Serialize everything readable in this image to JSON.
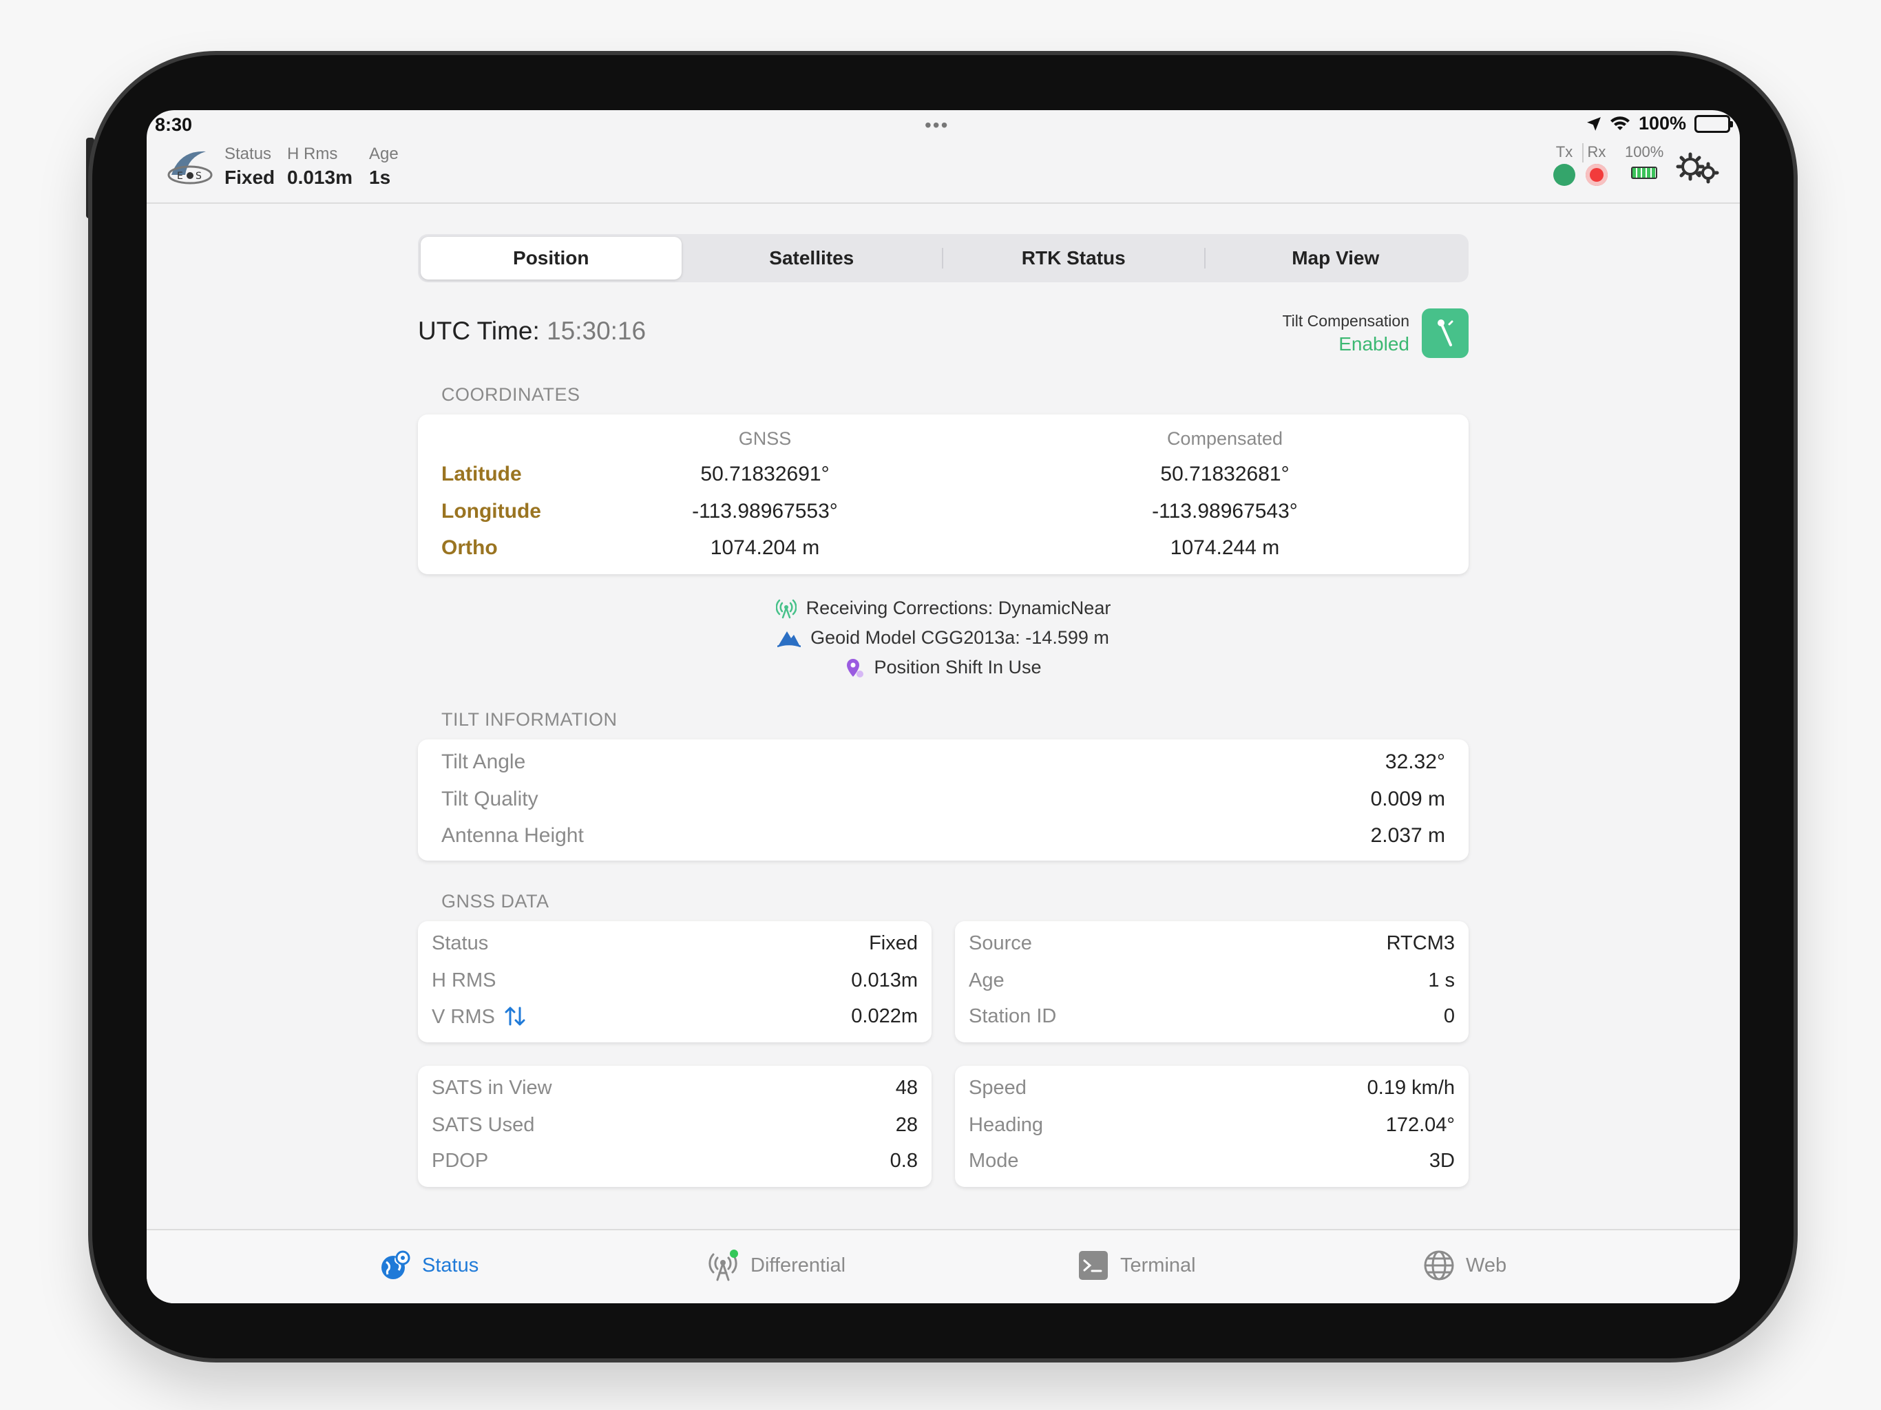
{
  "status_bar": {
    "time": "8:30",
    "battery": "100%"
  },
  "header": {
    "status_label": "Status",
    "status_value": "Fixed",
    "hrms_label": "H Rms",
    "hrms_value": "0.013m",
    "age_label": "Age",
    "age_value": "1s",
    "tx_label": "Tx",
    "rx_label": "Rx",
    "device_battery": "100%",
    "tx_color": "#34a56b",
    "rx_color": "#f23b3b"
  },
  "tabs": [
    "Position",
    "Satellites",
    "RTK Status",
    "Map View"
  ],
  "utc": {
    "label": "UTC Time:",
    "value": "15:30:16"
  },
  "tilt_compensation": {
    "label": "Tilt Compensation",
    "state": "Enabled"
  },
  "coordinates": {
    "title": "COORDINATES",
    "col_gnss": "GNSS",
    "col_comp": "Compensated",
    "rows": [
      {
        "name": "Latitude",
        "gnss": "50.71832691°",
        "comp": "50.71832681°"
      },
      {
        "name": "Longitude",
        "gnss": "-113.98967553°",
        "comp": "-113.98967543°"
      },
      {
        "name": "Ortho",
        "gnss": "1074.204 m",
        "comp": "1074.244 m"
      }
    ]
  },
  "info": {
    "corrections": "Receiving Corrections: DynamicNear",
    "geoid": "Geoid Model CGG2013a: -14.599 m",
    "shift": "Position Shift In Use"
  },
  "tilt_info": {
    "title": "TILT INFORMATION",
    "rows": [
      {
        "k": "Tilt Angle",
        "v": "32.32°"
      },
      {
        "k": "Tilt Quality",
        "v": "0.009 m"
      },
      {
        "k": "Antenna Height",
        "v": "2.037 m"
      }
    ]
  },
  "gnss_data": {
    "title": "GNSS DATA",
    "card1": [
      {
        "k": "Status",
        "v": "Fixed"
      },
      {
        "k": "H RMS",
        "v": "0.013m"
      },
      {
        "k": "V RMS",
        "v": "0.022m"
      }
    ],
    "card2": [
      {
        "k": "Source",
        "v": "RTCM3"
      },
      {
        "k": "Age",
        "v": "1 s"
      },
      {
        "k": "Station ID",
        "v": "0"
      }
    ],
    "card3": [
      {
        "k": "SATS in View",
        "v": "48"
      },
      {
        "k": "SATS Used",
        "v": "28"
      },
      {
        "k": "PDOP",
        "v": "0.8"
      }
    ],
    "card4": [
      {
        "k": "Speed",
        "v": "0.19 km/h"
      },
      {
        "k": "Heading",
        "v": "172.04°"
      },
      {
        "k": "Mode",
        "v": "3D"
      }
    ]
  },
  "tabbar": {
    "items": [
      {
        "label": "Status",
        "icon": "globe-pin-icon"
      },
      {
        "label": "Differential",
        "icon": "antenna-icon"
      },
      {
        "label": "Terminal",
        "icon": "terminal-icon"
      },
      {
        "label": "Web",
        "icon": "globe-icon"
      }
    ]
  },
  "colors": {
    "accent": "#1f7ad8",
    "gold": "#9a7421",
    "green": "#47c18a"
  }
}
